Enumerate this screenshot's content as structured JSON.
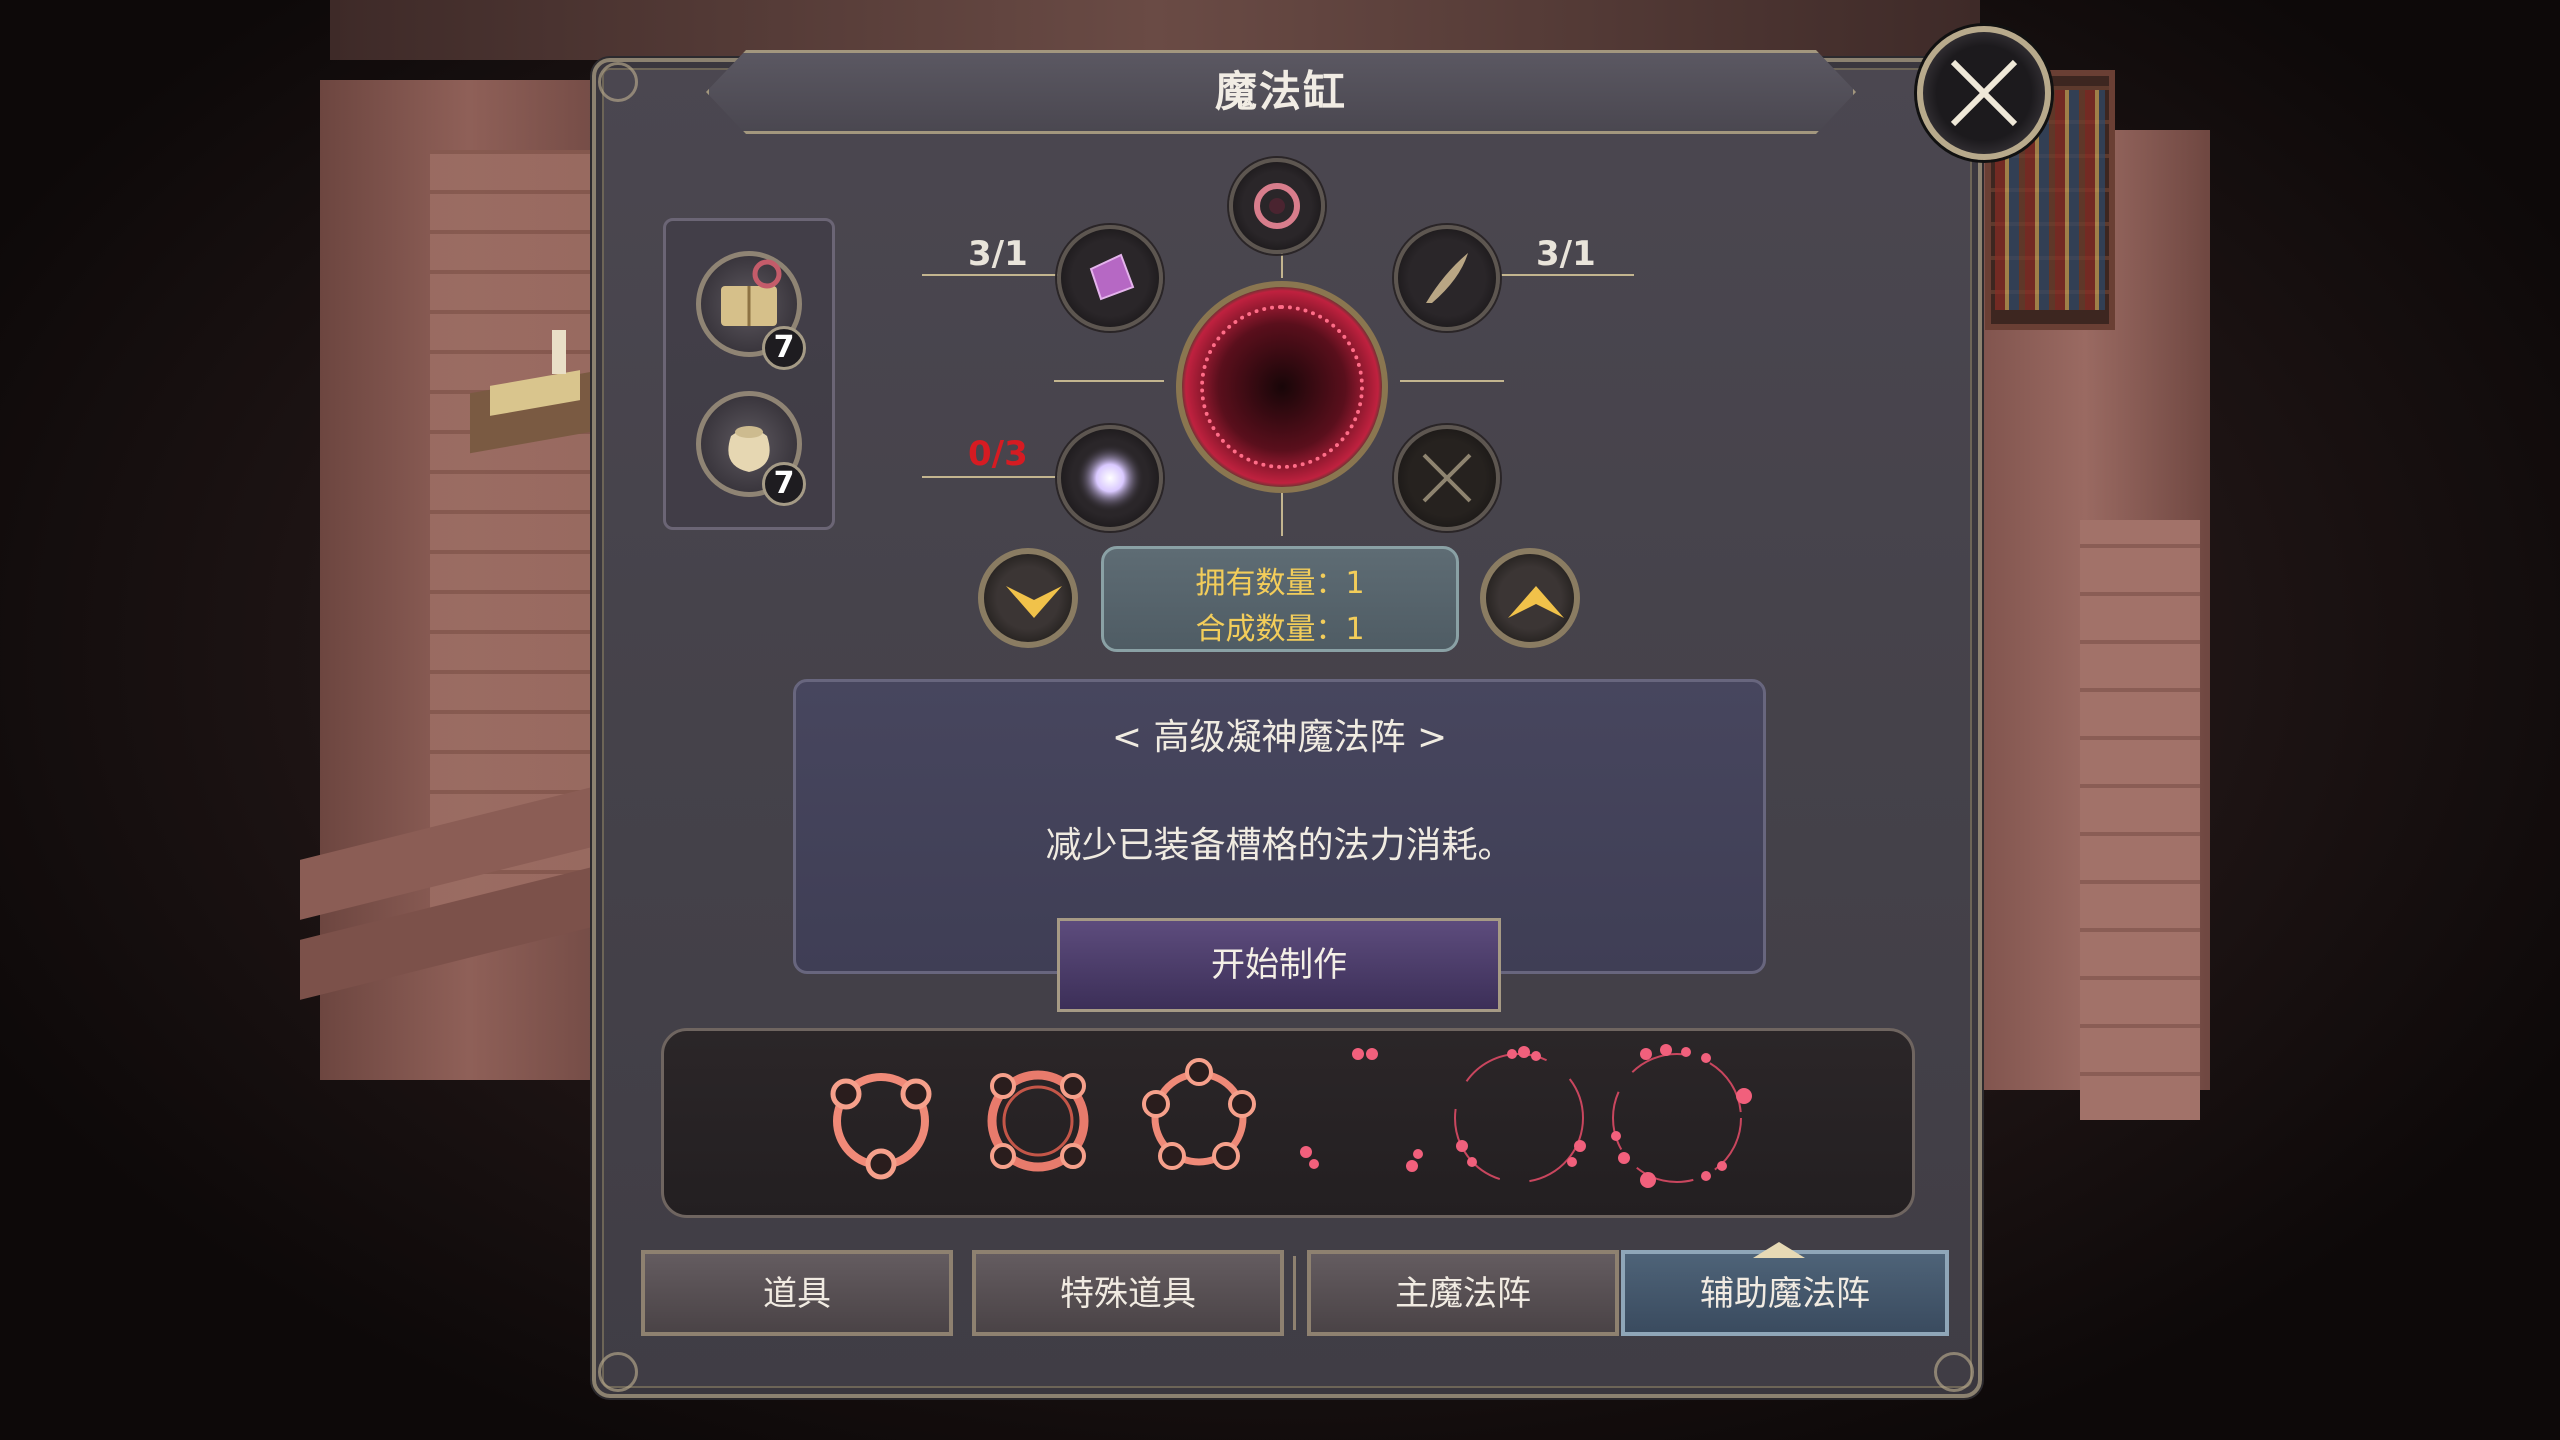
{
  "header": {
    "title": "魔法缸"
  },
  "materials": [
    {
      "icon": "spellbook-icon",
      "count": "7"
    },
    {
      "icon": "pouch-icon",
      "count": "7"
    }
  ],
  "slots": {
    "top_left": {
      "icon": "crystal-icon",
      "count": "3/1"
    },
    "top_right": {
      "icon": "quill-icon",
      "count": "3/1"
    },
    "bottom_left": {
      "icon": "light-orb-icon",
      "count": "0/3",
      "status_color": "#d61b22"
    },
    "bottom_right": {
      "icon": "locked-cross-icon"
    },
    "top_center": {
      "icon": "rune-emblem-icon"
    }
  },
  "quantity": {
    "owned": "拥有数量：1",
    "craft": "合成数量：1"
  },
  "description": {
    "name": "< 高级凝神魔法阵 >",
    "effect": "减少已装备槽格的法力消耗。"
  },
  "craft_button": "开始制作",
  "circles": [
    {
      "icon": "three-node-circle-icon"
    },
    {
      "icon": "four-node-circle-icon"
    },
    {
      "icon": "five-node-circle-icon"
    },
    {
      "icon": "scattered-dots-icon"
    },
    {
      "icon": "dotted-ring-icon"
    },
    {
      "icon": "dotted-ring-large-icon"
    }
  ],
  "tabs": [
    {
      "label": "道具",
      "active": false
    },
    {
      "label": "特殊道具",
      "active": false
    },
    {
      "label": "主魔法阵",
      "active": false
    },
    {
      "label": "辅助魔法阵",
      "active": true
    }
  ],
  "colors": {
    "accent_gold": "#f3cd5a",
    "magic_red": "#c0213f",
    "warn_red": "#d61b22"
  }
}
